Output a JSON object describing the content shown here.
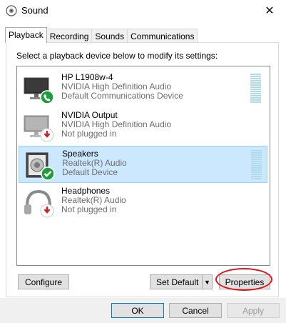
{
  "window": {
    "title": "Sound",
    "close_glyph": "✕"
  },
  "tabs": [
    {
      "label": "Playback",
      "active": true
    },
    {
      "label": "Recording",
      "active": false
    },
    {
      "label": "Sounds",
      "active": false
    },
    {
      "label": "Communications",
      "active": false
    }
  ],
  "instruction": "Select a playback device below to modify its settings:",
  "devices": [
    {
      "name": "HP L1908w-4",
      "line2": "NVIDIA High Definition Audio",
      "line3": "Default Communications Device",
      "icon": "monitor-icon",
      "badge": "phone-badge-icon",
      "selected": false
    },
    {
      "name": "NVIDIA Output",
      "line2": "NVIDIA High Definition Audio",
      "line3": "Not plugged in",
      "icon": "monitor-icon",
      "badge": "unplugged-arrow-icon",
      "selected": false
    },
    {
      "name": "Speakers",
      "line2": "Realtek(R) Audio",
      "line3": "Default Device",
      "icon": "speaker-icon",
      "badge": "default-check-icon",
      "selected": true
    },
    {
      "name": "Headphones",
      "line2": "Realtek(R) Audio",
      "line3": "Not plugged in",
      "icon": "headphones-icon",
      "badge": "unplugged-arrow-icon",
      "selected": false
    }
  ],
  "buttons": {
    "configure": "Configure",
    "set_default": "Set Default",
    "properties": "Properties",
    "ok": "OK",
    "cancel": "Cancel",
    "apply": "Apply"
  },
  "colors": {
    "selection": "#cce8ff",
    "check_green": "#1e9e3b",
    "unplug_red": "#d42020",
    "annotation_red": "#e0141e"
  }
}
